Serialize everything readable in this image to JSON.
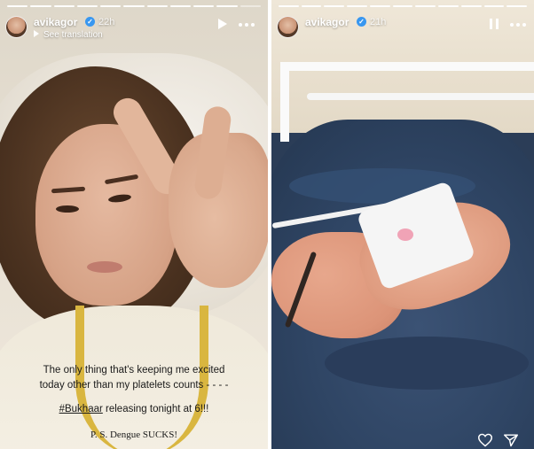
{
  "left_story": {
    "username": "avikagor",
    "age": "22h",
    "see_translation": "See translation",
    "progress": {
      "segments": 11,
      "completed": 10
    },
    "caption": {
      "line1": "The only thing that's keeping me excited",
      "line2": "today other than my platelets counts - - - -",
      "hashtag": "#Bukhaar",
      "line3_rest": " releasing tonight at 6!!!",
      "line4": "P. S. Dengue SUCKS!"
    },
    "icons": {
      "verified": "verified-badge-icon",
      "play": "play-icon",
      "more": "more-options-icon"
    }
  },
  "right_story": {
    "username": "avikagor",
    "age": "21h",
    "progress": {
      "segments": 11,
      "completed": 11
    },
    "icons": {
      "verified": "verified-badge-icon",
      "pause": "pause-icon",
      "more": "more-options-icon",
      "like": "heart-icon",
      "share": "send-icon"
    }
  },
  "colors": {
    "verified": "#3897f0",
    "gown_trim": "#d9b640",
    "blanket": "#2f4564"
  }
}
